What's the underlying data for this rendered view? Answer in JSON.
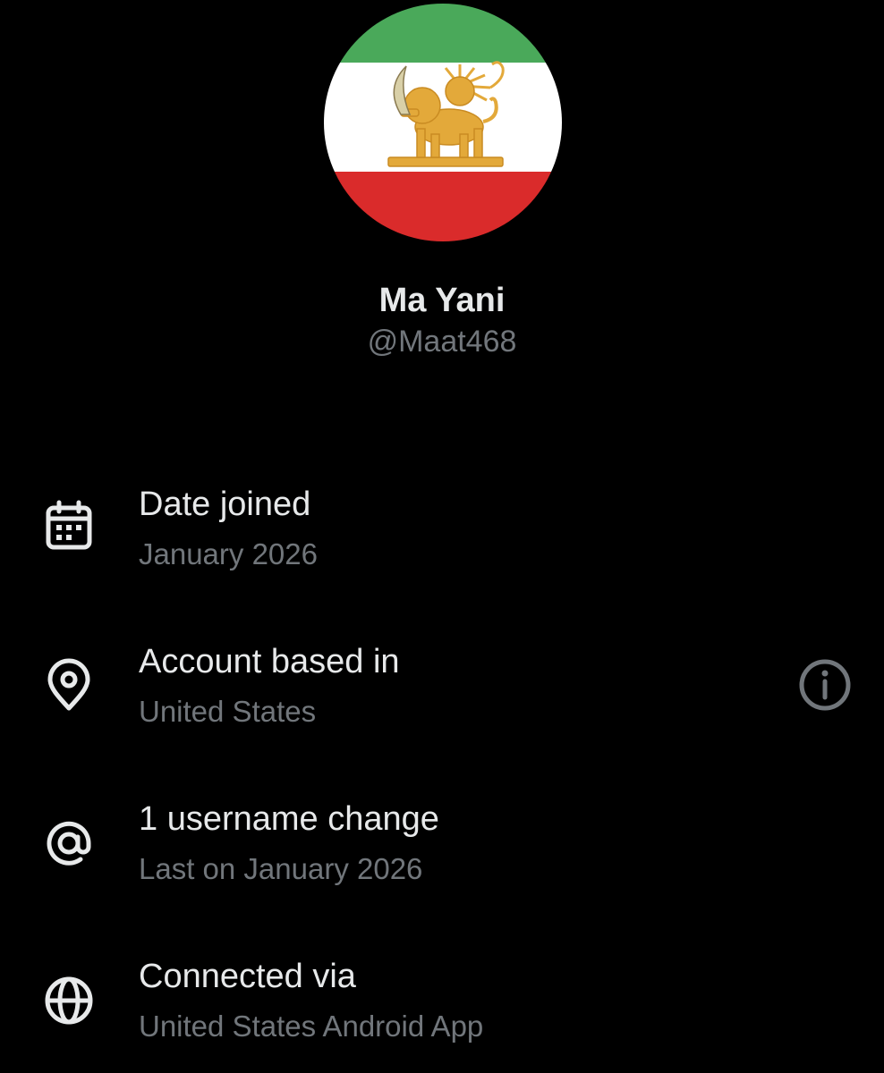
{
  "profile": {
    "display_name": "Ma Yani",
    "handle": "@Maat468",
    "avatar": {
      "icon": "lion-and-sun-flag-icon",
      "colors": {
        "green": "#4aa95a",
        "white": "#ffffff",
        "red": "#da2b2b",
        "emblem": "#e3a93a"
      }
    }
  },
  "about": {
    "items": [
      {
        "icon": "calendar-icon",
        "label": "Date joined",
        "value": "January 2026"
      },
      {
        "icon": "location-pin-icon",
        "label": "Account based in",
        "value": "United States",
        "trailing_icon": "info-icon"
      },
      {
        "icon": "at-sign-icon",
        "label": "1 username change",
        "value": "Last on January 2026"
      },
      {
        "icon": "globe-icon",
        "label": "Connected via",
        "value": "United States Android App"
      }
    ]
  },
  "theme": {
    "background": "#000000",
    "primary_text": "#e7e9ea",
    "secondary_text": "#71767b"
  }
}
